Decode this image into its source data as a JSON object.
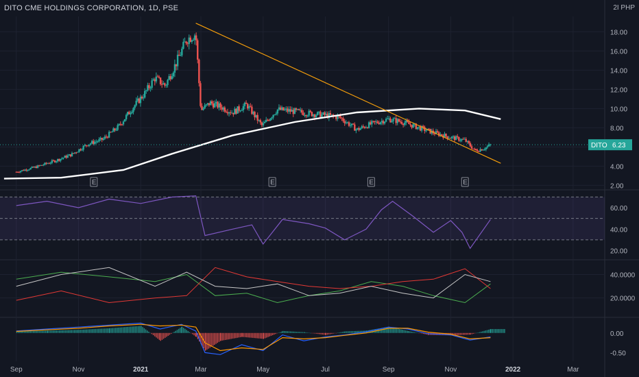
{
  "header": {
    "title": "DITO CME HOLDINGS CORPORATION, 1D, PSE",
    "currency": "2I PHP"
  },
  "price_tag": {
    "symbol": "DITO",
    "value": "6.23"
  },
  "earnings_marker": "E",
  "colors": {
    "background": "#131722",
    "grid": "#1e2230",
    "up": "#26a69a",
    "down": "#ef5350",
    "trendline": "#f59e0b",
    "ma": "#ffffff",
    "rsi": "#7e57c2",
    "rsi_band": "#7e57c2",
    "di_plus": "#4caf50",
    "di_minus": "#e53935",
    "adx": "#c8c8c8",
    "macd": "#2962ff",
    "signal": "#ff9800",
    "tag": "#26a69a"
  },
  "chart_data": [
    {
      "type": "candlestick",
      "title": "DITO CME HOLDINGS CORPORATION, 1D, PSE",
      "y_ticks": [
        "18.00",
        "16.00",
        "14.00",
        "12.00",
        "10.00",
        "8.00",
        "6.00",
        "4.00",
        "2.00"
      ],
      "ylim": [
        1.6,
        19.6
      ],
      "x_ticks": [
        "Sep",
        "Nov",
        "2021",
        "Mar",
        "May",
        "Jul",
        "Sep",
        "Nov",
        "2022",
        "Mar"
      ],
      "close_path": {
        "x": [
          "2020-09-01",
          "2020-09-20",
          "2020-10-10",
          "2020-10-25",
          "2020-11-10",
          "2020-11-25",
          "2020-12-10",
          "2020-12-25",
          "2021-01-05",
          "2021-01-15",
          "2021-01-25",
          "2021-02-05",
          "2021-02-15",
          "2021-02-24",
          "2021-03-01",
          "2021-03-10",
          "2021-03-20",
          "2021-04-01",
          "2021-04-15",
          "2021-04-30",
          "2021-05-15",
          "2021-06-01",
          "2021-06-15",
          "2021-07-01",
          "2021-07-15",
          "2021-08-01",
          "2021-08-15",
          "2021-09-01",
          "2021-09-15",
          "2021-10-01",
          "2021-10-15",
          "2021-11-01",
          "2021-11-15",
          "2021-11-25",
          "2021-12-05",
          "2021-12-10"
        ],
        "close": [
          3.4,
          3.9,
          4.6,
          5.2,
          6.3,
          6.8,
          8.1,
          10.2,
          11.6,
          13.2,
          12.4,
          14.8,
          17.2,
          17.8,
          9.8,
          10.6,
          10.2,
          9.6,
          10.4,
          8.2,
          9.9,
          9.7,
          9.5,
          9.3,
          9.1,
          7.8,
          8.4,
          8.9,
          8.6,
          8.0,
          7.5,
          7.0,
          6.7,
          5.6,
          5.9,
          6.23
        ]
      },
      "last_price": 6.23,
      "ma_200": {
        "x": [
          "2020-08-20",
          "2020-10-15",
          "2020-12-15",
          "2021-02-01",
          "2021-04-01",
          "2021-06-01",
          "2021-08-01",
          "2021-10-01",
          "2021-11-15",
          "2021-12-20"
        ],
        "y": [
          2.7,
          2.8,
          3.6,
          5.3,
          7.2,
          8.6,
          9.6,
          10.0,
          9.8,
          8.9
        ]
      },
      "trendline": {
        "x": [
          "2021-02-24",
          "2021-12-20"
        ],
        "y": [
          18.9,
          4.3
        ]
      },
      "earnings_dates": [
        "2020-11-16",
        "2021-05-10",
        "2021-08-15",
        "2021-11-15"
      ]
    },
    {
      "type": "line",
      "name": "RSI",
      "y_ticks": [
        "60.00",
        "40.00",
        "20.00"
      ],
      "ylim": [
        12,
        76
      ],
      "band": [
        30,
        70
      ],
      "middle": 50,
      "x": [
        "2020-09-01",
        "2020-10-01",
        "2020-11-01",
        "2020-12-01",
        "2021-01-01",
        "2021-02-01",
        "2021-02-24",
        "2021-03-05",
        "2021-04-01",
        "2021-04-20",
        "2021-05-01",
        "2021-05-20",
        "2021-06-15",
        "2021-07-01",
        "2021-07-20",
        "2021-08-10",
        "2021-08-25",
        "2021-09-05",
        "2021-09-25",
        "2021-10-15",
        "2021-11-01",
        "2021-11-12",
        "2021-11-20",
        "2021-12-10"
      ],
      "y": [
        62,
        66,
        60,
        68,
        64,
        70,
        71,
        34,
        40,
        44,
        26,
        49,
        45,
        41,
        30,
        40,
        58,
        66,
        52,
        37,
        48,
        37,
        22,
        49
      ]
    },
    {
      "type": "line",
      "name": "DMI",
      "y_ticks": [
        "40.0000",
        "20.0000"
      ],
      "ylim": [
        4,
        52
      ],
      "series": [
        {
          "x": [
            "2020-09-01",
            "2020-10-15",
            "2020-12-01",
            "2021-01-15",
            "2021-02-15",
            "2021-03-15",
            "2021-04-15",
            "2021-05-15",
            "2021-06-15",
            "2021-07-15",
            "2021-08-15",
            "2021-09-15",
            "2021-10-15",
            "2021-11-15",
            "2021-12-10"
          ],
          "y": [
            36,
            42,
            38,
            34,
            40,
            22,
            24,
            16,
            22,
            26,
            34,
            30,
            22,
            16,
            32
          ]
        },
        {
          "x": [
            "2020-09-01",
            "2020-10-15",
            "2020-12-01",
            "2021-01-15",
            "2021-02-15",
            "2021-03-15",
            "2021-04-15",
            "2021-05-15",
            "2021-06-15",
            "2021-07-15",
            "2021-08-15",
            "2021-09-15",
            "2021-10-15",
            "2021-11-15",
            "2021-12-10"
          ],
          "y": [
            18,
            26,
            16,
            20,
            22,
            46,
            38,
            34,
            30,
            28,
            30,
            34,
            36,
            45,
            28
          ]
        },
        {
          "x": [
            "2020-09-01",
            "2020-10-15",
            "2020-12-01",
            "2021-01-15",
            "2021-02-15",
            "2021-03-15",
            "2021-04-15",
            "2021-05-15",
            "2021-06-15",
            "2021-07-15",
            "2021-08-15",
            "2021-09-15",
            "2021-10-15",
            "2021-11-15",
            "2021-12-10"
          ],
          "y": [
            30,
            40,
            46,
            30,
            42,
            30,
            28,
            32,
            22,
            24,
            30,
            24,
            20,
            40,
            34
          ]
        }
      ]
    },
    {
      "type": "bar",
      "name": "MACD",
      "y_ticks": [
        "0.00",
        "-0.50"
      ],
      "ylim": [
        -0.72,
        0.38
      ],
      "x": [
        "2020-09-01",
        "2020-10-01",
        "2020-11-01",
        "2020-12-01",
        "2021-01-01",
        "2021-01-20",
        "2021-02-10",
        "2021-02-24",
        "2021-03-05",
        "2021-03-20",
        "2021-04-10",
        "2021-05-01",
        "2021-05-20",
        "2021-06-10",
        "2021-07-01",
        "2021-07-20",
        "2021-08-10",
        "2021-09-01",
        "2021-09-20",
        "2021-10-10",
        "2021-11-01",
        "2021-11-20",
        "2021-12-10"
      ],
      "histogram": [
        0.04,
        0.06,
        0.08,
        0.12,
        0.18,
        -0.2,
        0.16,
        -0.1,
        -0.45,
        -0.2,
        -0.1,
        -0.15,
        0.05,
        0.02,
        -0.05,
        0.04,
        0.06,
        0.16,
        0.05,
        -0.05,
        -0.06,
        -0.04,
        0.1
      ],
      "macd": [
        0.05,
        0.1,
        0.15,
        0.2,
        0.25,
        0.1,
        0.22,
        0.05,
        -0.5,
        -0.55,
        -0.3,
        -0.45,
        -0.05,
        -0.2,
        -0.1,
        -0.05,
        0.03,
        0.15,
        0.1,
        -0.02,
        -0.05,
        -0.18,
        -0.1
      ],
      "signal": [
        0.04,
        0.08,
        0.12,
        0.18,
        0.22,
        0.18,
        0.2,
        0.15,
        -0.25,
        -0.45,
        -0.38,
        -0.42,
        -0.12,
        -0.15,
        -0.12,
        -0.06,
        0.0,
        0.12,
        0.12,
        0.02,
        -0.03,
        -0.15,
        -0.12
      ]
    }
  ]
}
